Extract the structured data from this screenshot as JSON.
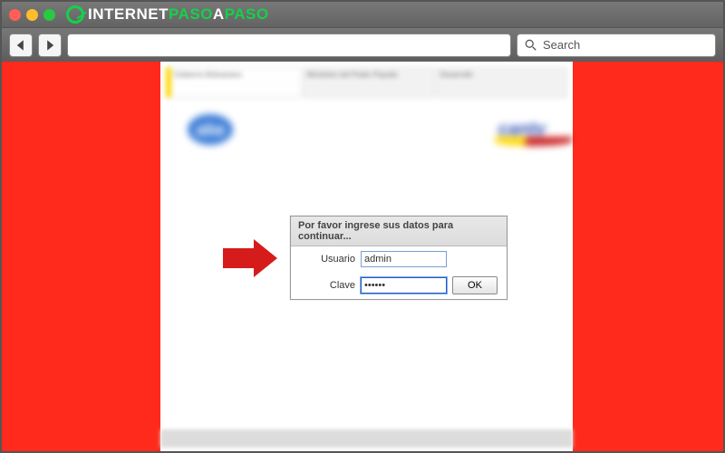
{
  "brand": {
    "part1": "INTERNET",
    "part2": "PASO",
    "part3": "A",
    "part4": "PASO"
  },
  "search": {
    "placeholder": "Search"
  },
  "logos": {
    "aba": "aba",
    "cantv": "cantv"
  },
  "login": {
    "title": "Por favor ingrese sus datos para continuar...",
    "user_label": "Usuario",
    "user_value": "admin",
    "password_label": "Clave",
    "password_value": "••••••",
    "ok_label": "OK"
  }
}
